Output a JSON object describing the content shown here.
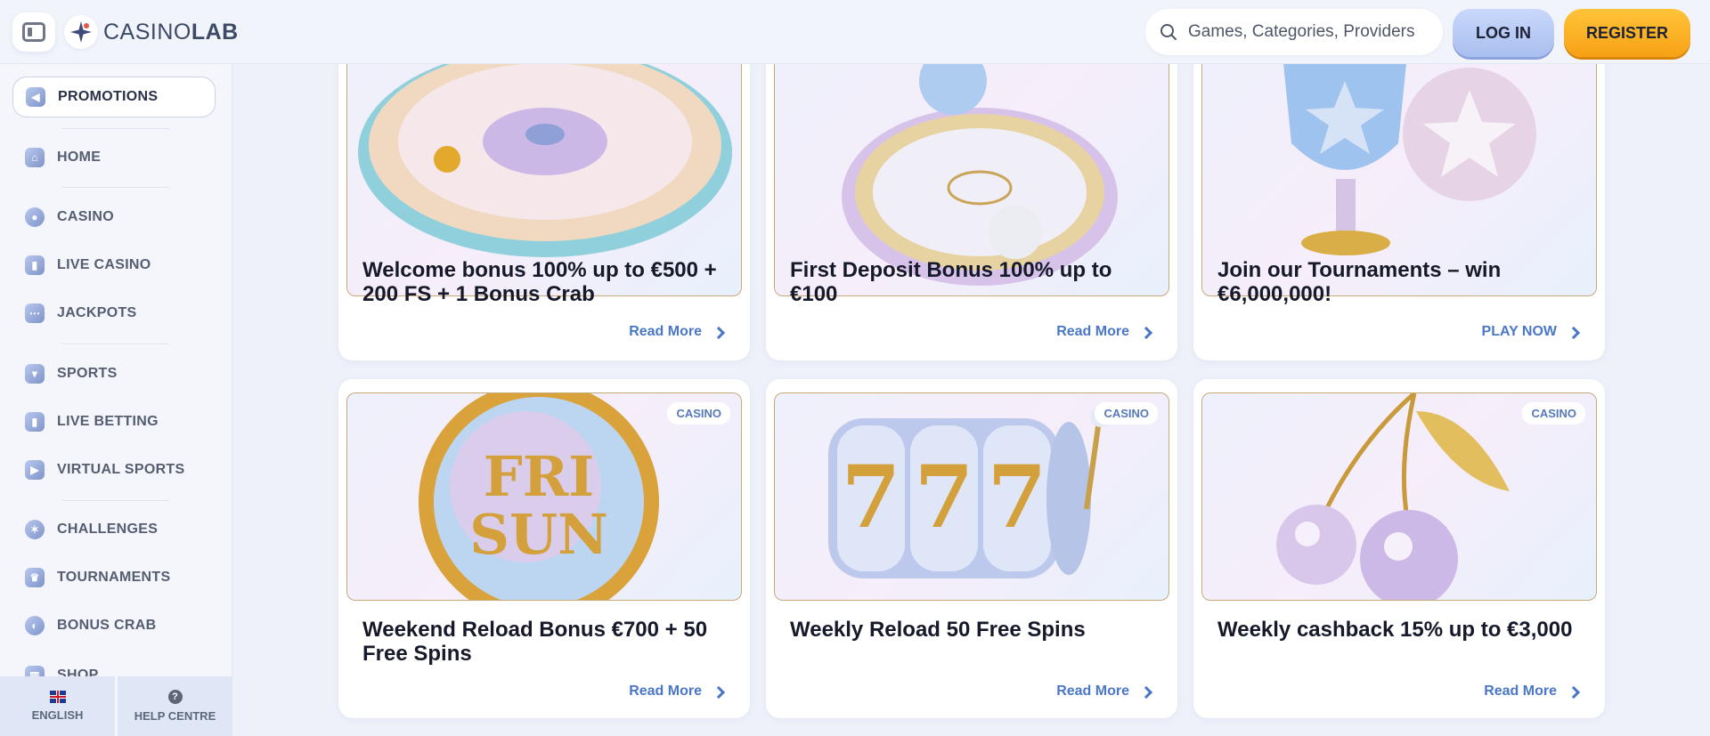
{
  "header": {
    "logo": {
      "part1": "CASINO",
      "part2": "LAB"
    },
    "search_placeholder": "Games, Categories, Providers",
    "login_label": "LOG IN",
    "register_label": "REGISTER"
  },
  "sidebar": {
    "items": [
      {
        "label": "PROMOTIONS",
        "icon": "megaphone-icon",
        "active": true
      },
      {
        "label": "HOME",
        "icon": "home-icon"
      },
      {
        "label": "CASINO",
        "icon": "chip-icon"
      },
      {
        "label": "LIVE CASINO",
        "icon": "live-cards-icon"
      },
      {
        "label": "JACKPOTS",
        "icon": "jackpot-icon"
      },
      {
        "label": "SPORTS",
        "icon": "sports-icon"
      },
      {
        "label": "LIVE BETTING",
        "icon": "live-betting-icon"
      },
      {
        "label": "VIRTUAL SPORTS",
        "icon": "play-icon"
      },
      {
        "label": "CHALLENGES",
        "icon": "challenges-icon"
      },
      {
        "label": "TOURNAMENTS",
        "icon": "trophy-icon"
      },
      {
        "label": "BONUS CRAB",
        "icon": "crab-icon"
      },
      {
        "label": "SHOP",
        "icon": "shop-icon"
      }
    ],
    "language_label": "ENGLISH",
    "help_label": "HELP CENTRE",
    "help_glyph": "?"
  },
  "promotions": [
    {
      "title": "Welcome bonus 100% up to €500 + 200 FS + 1 Bonus Crab",
      "link": "Read More",
      "art": "roulette-wheel"
    },
    {
      "title": "First Deposit Bonus 100% up to €100",
      "link": "Read More",
      "art": "football-pitch"
    },
    {
      "title": "Join our Tournaments – win €6,000,000!",
      "link": "PLAY NOW",
      "art": "trophy-and-ball"
    },
    {
      "title": "Weekend Reload Bonus €700 + 50 Free Spins",
      "link": "Read More",
      "badge": "CASINO",
      "art": "fri-sun-orb",
      "art_text1": "FRI",
      "art_text2": "SUN"
    },
    {
      "title": "Weekly Reload 50 Free Spins",
      "link": "Read More",
      "badge": "CASINO",
      "art": "slot-reels",
      "art_text": "7"
    },
    {
      "title": "Weekly cashback 15% up to €3,000",
      "link": "Read More",
      "badge": "CASINO",
      "art": "cherries"
    }
  ]
}
